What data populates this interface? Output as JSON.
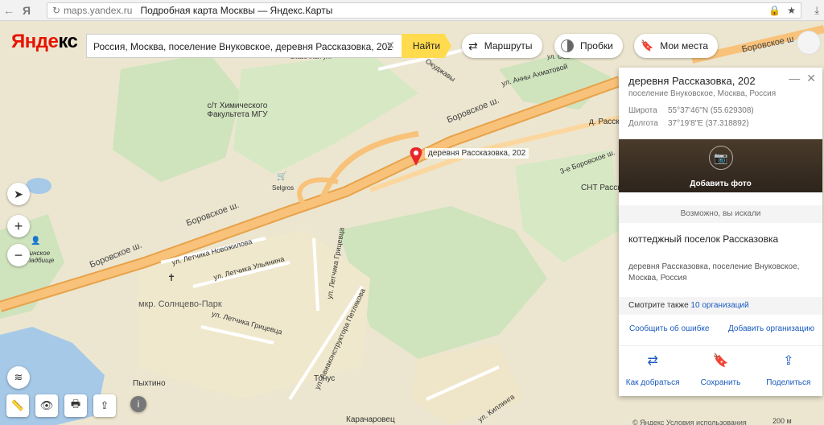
{
  "browser": {
    "url": "maps.yandex.ru",
    "title": "Подробная карта Москвы — Яндекс.Карты"
  },
  "header": {
    "logo_main": "Янде",
    "logo_rest": "кс",
    "search_value": "Россия, Москва, поселение Внуковское, деревня Рассказовка, 202",
    "find_label": "Найти",
    "routes_label": "Маршруты",
    "traffic_label": "Пробки",
    "places_label": "Мои места"
  },
  "map": {
    "labels": {
      "pin": "деревня Рассказовка, 202",
      "coop": "с/т Химического Факультета МГУ",
      "selgros": "Selgros",
      "borovskoe1": "Боровское ш.",
      "borovskoe2": "Боровское ш.",
      "borovskoe3": "Боровское ш.",
      "borovskoe4": "Боровское ш",
      "novozhilova": "ул. Летчика Новожилова",
      "ulyanina": "ул. Летчика Ульянина",
      "grittseva": "ул. Летчика Грицевца",
      "grittseva2": "ул. Летчика Грицевца",
      "petlyakova": "ул. Авиаконструктора Петлякова",
      "solntsevo": "мкр. Солнцево-Парк",
      "pyhtino": "Пыхтино",
      "tonus": "Тонус",
      "karacharovets": "Карачаровец",
      "snt": "СНТ Расск",
      "d_rass": "д. Расск",
      "third_borovskoy": "3-е Боровское ш.",
      "cemetery": "тинское кладбище",
      "okudzhavy": "Окуджавы",
      "annae": "ул. Анны Ахматовой",
      "skazochnaya": "Сказочная ул.",
      "semy": "ул. Сем",
      "kipling": "ул. Киплинга"
    }
  },
  "panel": {
    "title": "деревня Рассказовка, 202",
    "subtitle": "поселение Внуковское, Москва, Россия",
    "lat_key": "Широта",
    "lat_val": "55°37'46\"N (55.629308)",
    "lon_key": "Долгота",
    "lon_val": "37°19'8\"E (37.318892)",
    "add_photo": "Добавить фото",
    "maybe": "Возможно, вы искали",
    "org_title": "коттеджный поселок Рассказовка",
    "org_addr": "деревня Рассказовка, поселение Внуковское, Москва, Россия",
    "see_also_prefix": "Смотрите также",
    "see_also_link": "10 организаций",
    "report_error": "Сообщить об ошибке",
    "add_org": "Добавить организацию",
    "action_route": "Как добраться",
    "action_save": "Сохранить",
    "action_share": "Поделиться"
  },
  "footer": {
    "copyright": "© Яндекс Условия использования",
    "scale": "200 м"
  },
  "colors": {
    "accent": "#ffdb4d",
    "logo_red": "#e61400",
    "road": "#f5b865",
    "forest": "#cfe3bd",
    "water": "#a6c9e8",
    "link": "#1a5bbf"
  }
}
